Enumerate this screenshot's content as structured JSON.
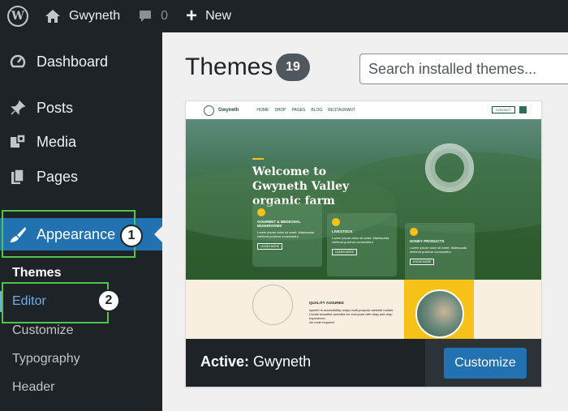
{
  "adminbar": {
    "site_name": "Gwyneth",
    "comments_count": "0",
    "new_label": "New"
  },
  "sidebar": {
    "items": [
      {
        "label": "Dashboard",
        "icon": "dashboard-icon"
      },
      {
        "label": "Posts",
        "icon": "pin-icon"
      },
      {
        "label": "Media",
        "icon": "media-icon"
      },
      {
        "label": "Pages",
        "icon": "pages-icon"
      },
      {
        "label": "Appearance",
        "icon": "paintbrush-icon"
      }
    ],
    "submenu": [
      "Themes",
      "Editor",
      "Customize",
      "Typography",
      "Header"
    ]
  },
  "callouts": [
    "1",
    "2"
  ],
  "main": {
    "title": "Themes",
    "count": "19",
    "search_placeholder": "Search installed themes..."
  },
  "theme_card": {
    "active_prefix": "Active:",
    "theme_name": "Gwyneth",
    "customize_label": "Customize"
  },
  "preview": {
    "brand": "Gwyneth",
    "nav_links": [
      "HOME",
      "SHOP",
      "PAGES",
      "BLOG",
      "RESTAURANT"
    ],
    "contact": "CONTACT",
    "headline_lines": [
      "Welcome to",
      "Gwyneth Valley",
      "organic farm"
    ],
    "boxes": [
      {
        "title": "GOURMET & MEDICINAL MUSHROOMS",
        "text": "Lorem ipsum dolor sit amet. Malesuada eleifend pulvinar consectetur",
        "link": "LEARN MORE"
      },
      {
        "title": "LIVESTOCK",
        "text": "Lorem ipsum dolor sit amet. Malesuada eleifend pulvinar consectetur",
        "link": "LEARN MORE"
      },
      {
        "title": "HONEY PRODUCTS",
        "text": "Lorem ipsum dolor sit amet. Malesuada eleifend pulvinar consectetur",
        "link": "KNOW MORE"
      }
    ],
    "quality_heading": "QUALITY ASSURED",
    "quality_text": "wyneth is accessibility ready multi-purpose website builder. Create beautiful websites for everyone with drag and drop experience.",
    "quality_note": "No code required"
  }
}
